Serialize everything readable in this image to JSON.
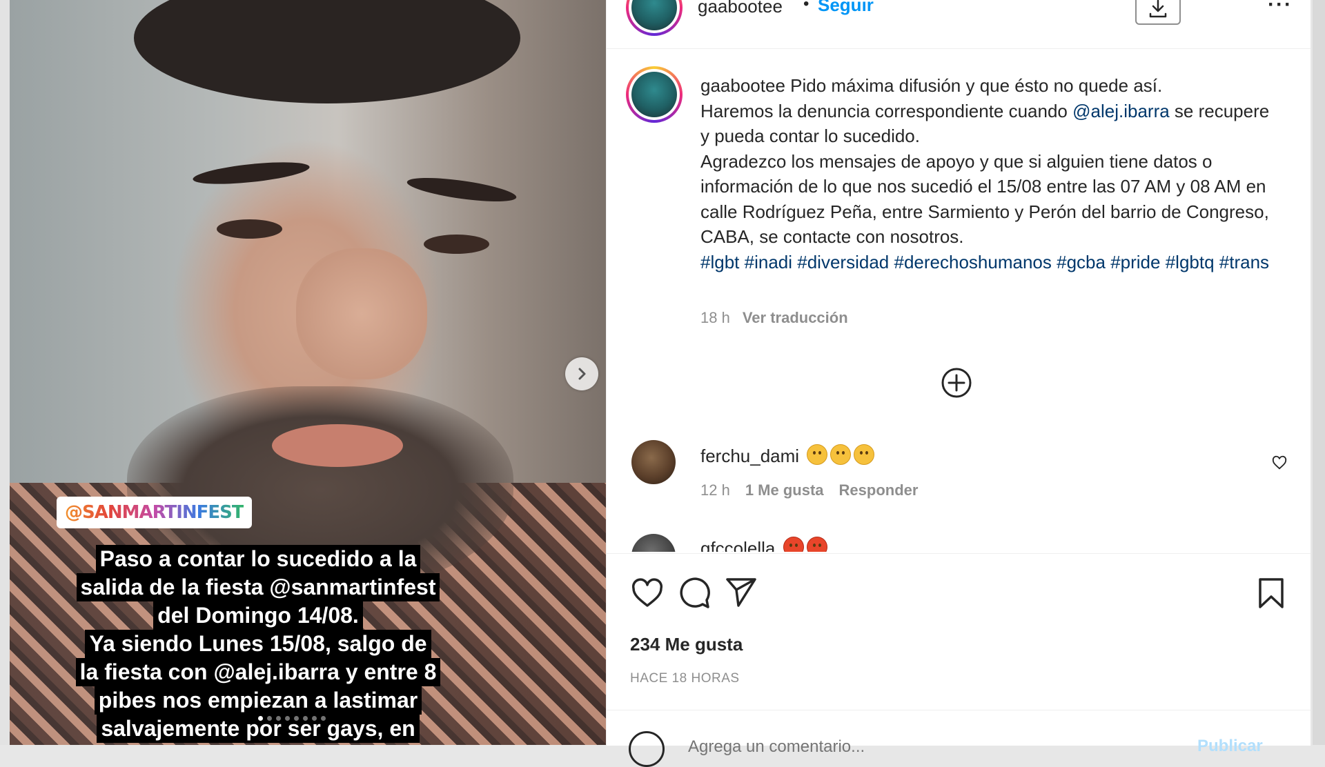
{
  "post": {
    "username": "gaabootee",
    "separator": "•",
    "follow_label": "Seguir",
    "more_label": "···"
  },
  "photo": {
    "tag": "@SANMARTINFEST",
    "story_lines": [
      "Paso a contar lo sucedido a la",
      "salida de la fiesta @sanmartinfest",
      "del Domingo 14/08.",
      "Ya siendo Lunes 15/08, salgo de",
      "la fiesta con @alej.ibarra y entre 8",
      "pibes nos empiezan a lastimar",
      "salvajemente por ser gays, en"
    ],
    "carousel_count": 8,
    "carousel_active": 0
  },
  "caption": {
    "username": "gaabootee",
    "text_1": " Pido máxima difusión y que ésto no quede así.",
    "text_2": "Haremos la denuncia correspondiente cuando ",
    "mention": "@alej.ibarra",
    "text_3": " se recupere y pueda contar lo sucedido.",
    "text_4": "Agradezco los mensajes de apoyo y que si alguien tiene datos o información de lo que nos sucedió el 15/08 entre las 07 AM y 08 AM en calle Rodríguez Peña, entre Sarmiento y Perón del barrio de Congreso, CABA, se contacte con nosotros.",
    "hashtags": [
      "#lgbt",
      "#inadi",
      "#diversidad",
      "#derechoshumanos",
      "#gcba",
      "#pride",
      "#lgbtq",
      "#trans"
    ],
    "age": "18 h",
    "translate_label": "Ver traducción"
  },
  "comments": [
    {
      "username": "ferchu_dami",
      "emojis": [
        "sad",
        "sad",
        "sad"
      ],
      "age": "12 h",
      "likes": "1 Me gusta",
      "reply_label": "Responder"
    },
    {
      "username": "gfccolella",
      "emojis": [
        "angry",
        "angry"
      ]
    }
  ],
  "actions": {
    "likes_text": "234 Me gusta",
    "timestamp": "HACE 18 HORAS"
  },
  "comment_box": {
    "placeholder": "Agrega un comentario...",
    "publish_label": "Publicar"
  },
  "colors": {
    "accent": "#0095f6",
    "link": "#00376b",
    "muted": "#8e8e8e",
    "text": "#262626"
  }
}
